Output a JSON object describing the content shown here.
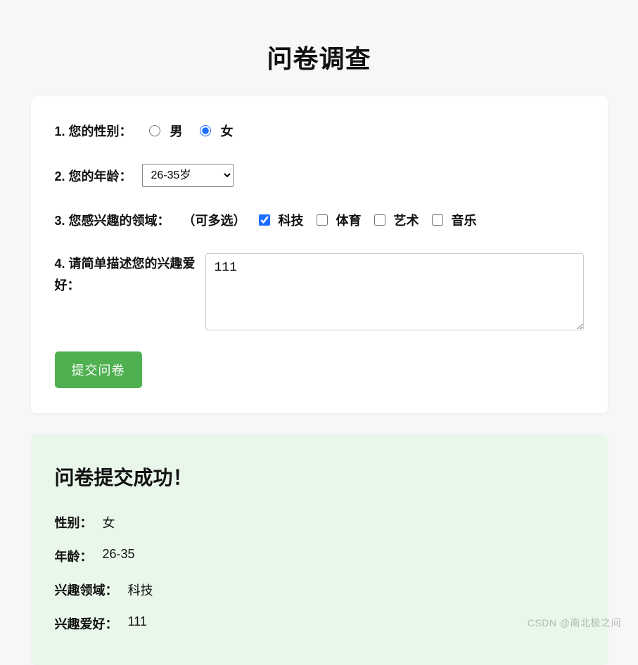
{
  "title": "问卷调查",
  "form": {
    "q1": {
      "label": "1. 您的性别：",
      "options": {
        "male": "男",
        "female": "女"
      },
      "selected": "female"
    },
    "q2": {
      "label": "2. 您的年龄：",
      "selected": "26-35岁",
      "options": [
        "26-35岁"
      ]
    },
    "q3": {
      "label": "3. 您感兴趣的领域：",
      "hint": "（可多选）",
      "options": {
        "tech": "科技",
        "sport": "体育",
        "art": "艺术",
        "music": "音乐"
      },
      "selected": [
        "tech"
      ]
    },
    "q4": {
      "label": "4. 请简单描述您的兴趣爱好：",
      "value": "111"
    },
    "submit": "提交问卷"
  },
  "result": {
    "title": "问卷提交成功！",
    "rows": {
      "gender": {
        "label": "性别：",
        "value": "女"
      },
      "age": {
        "label": "年龄：",
        "value": "26-35"
      },
      "field": {
        "label": "兴趣领域：",
        "value": "科技"
      },
      "hobby": {
        "label": "兴趣爱好：",
        "value": "111"
      }
    }
  },
  "watermark": "CSDN @南北极之间"
}
